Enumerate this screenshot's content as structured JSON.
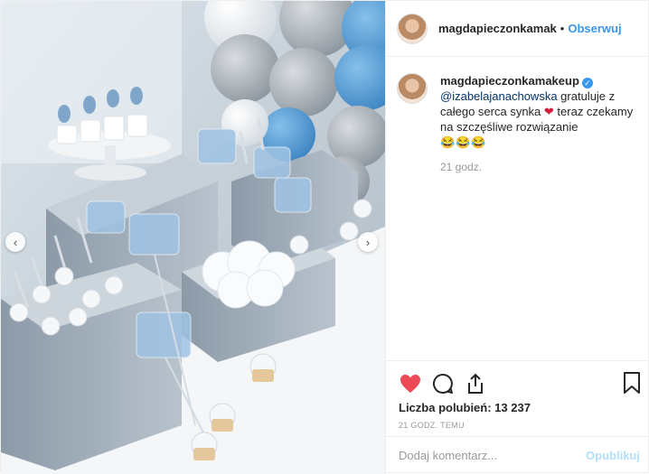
{
  "header": {
    "username": "magdapieczonkamak",
    "separator": "•",
    "follow_label": "Obserwuj",
    "more_icon": "more-icon"
  },
  "comment": {
    "username": "magdapieczonkamakeup",
    "verified": true,
    "mention": "@izabelajanachowska",
    "text_before_heart": " gratuluje z całego serca synka ",
    "heart": "❤",
    "text_after_heart": " teraz czekamy na szczęśliwe rozwiązanie",
    "emojis": "😂😂😂",
    "time": "21 godz."
  },
  "actions": {
    "like_icon": "heart-icon",
    "comment_icon": "comment-icon",
    "share_icon": "share-icon",
    "save_icon": "bookmark-icon",
    "liked": true,
    "like_color": "#ed4956"
  },
  "likes": {
    "label": "Liczba polubień: 13 237"
  },
  "post_time": "21 GODZ. TEMU",
  "add_comment": {
    "placeholder": "Dodaj komentarz...",
    "publish_label": "Opublikuj"
  },
  "carousel": {
    "prev_icon": "chevron-left-icon",
    "next_icon": "chevron-right-icon"
  }
}
